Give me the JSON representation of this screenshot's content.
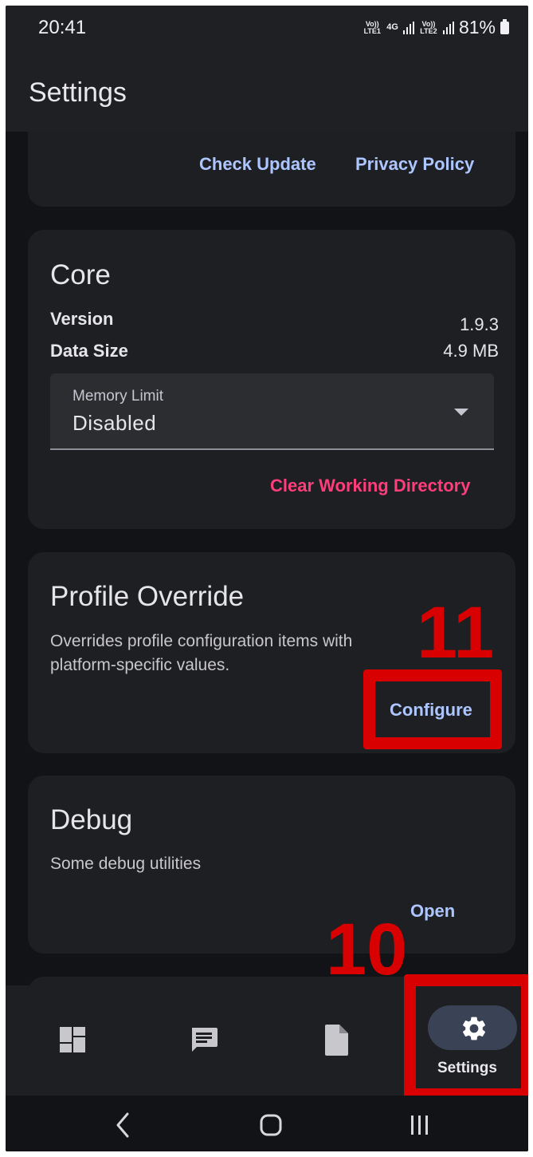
{
  "status_bar": {
    "time": "20:41",
    "sim1_label": "Vo)) LTE1",
    "network_type": "4G",
    "sim2_label": "Vo)) LTE2",
    "battery": "81%"
  },
  "app_bar": {
    "title": "Settings"
  },
  "about_card": {
    "check_update": "Check Update",
    "privacy_policy": "Privacy Policy"
  },
  "core_card": {
    "title": "Core",
    "version_label": "Version",
    "version_value": "1.9.3",
    "data_size_label": "Data Size",
    "data_size_value": "4.9 MB",
    "memory_limit_label": "Memory Limit",
    "memory_limit_value": "Disabled",
    "clear_working_directory": "Clear Working Directory"
  },
  "profile_override_card": {
    "title": "Profile Override",
    "description": "Overrides profile configuration items with platform-specific values.",
    "configure": "Configure"
  },
  "debug_card": {
    "title": "Debug",
    "description": "Some debug utilities",
    "open": "Open"
  },
  "annotations": {
    "configure_step": "11",
    "settings_step": "10"
  },
  "bottom_nav": {
    "items": [
      {
        "icon": "dashboard-icon",
        "label": ""
      },
      {
        "icon": "message-icon",
        "label": ""
      },
      {
        "icon": "file-icon",
        "label": ""
      },
      {
        "icon": "gear-icon",
        "label": "Settings",
        "selected": true
      }
    ]
  },
  "colors": {
    "background": "#121316",
    "surface": "#1e1f22",
    "primary_text_button": "#aec6ff",
    "danger_text_button": "#ff3d7a",
    "annotation_red": "#d80000",
    "nav_indicator": "#3a4255"
  }
}
